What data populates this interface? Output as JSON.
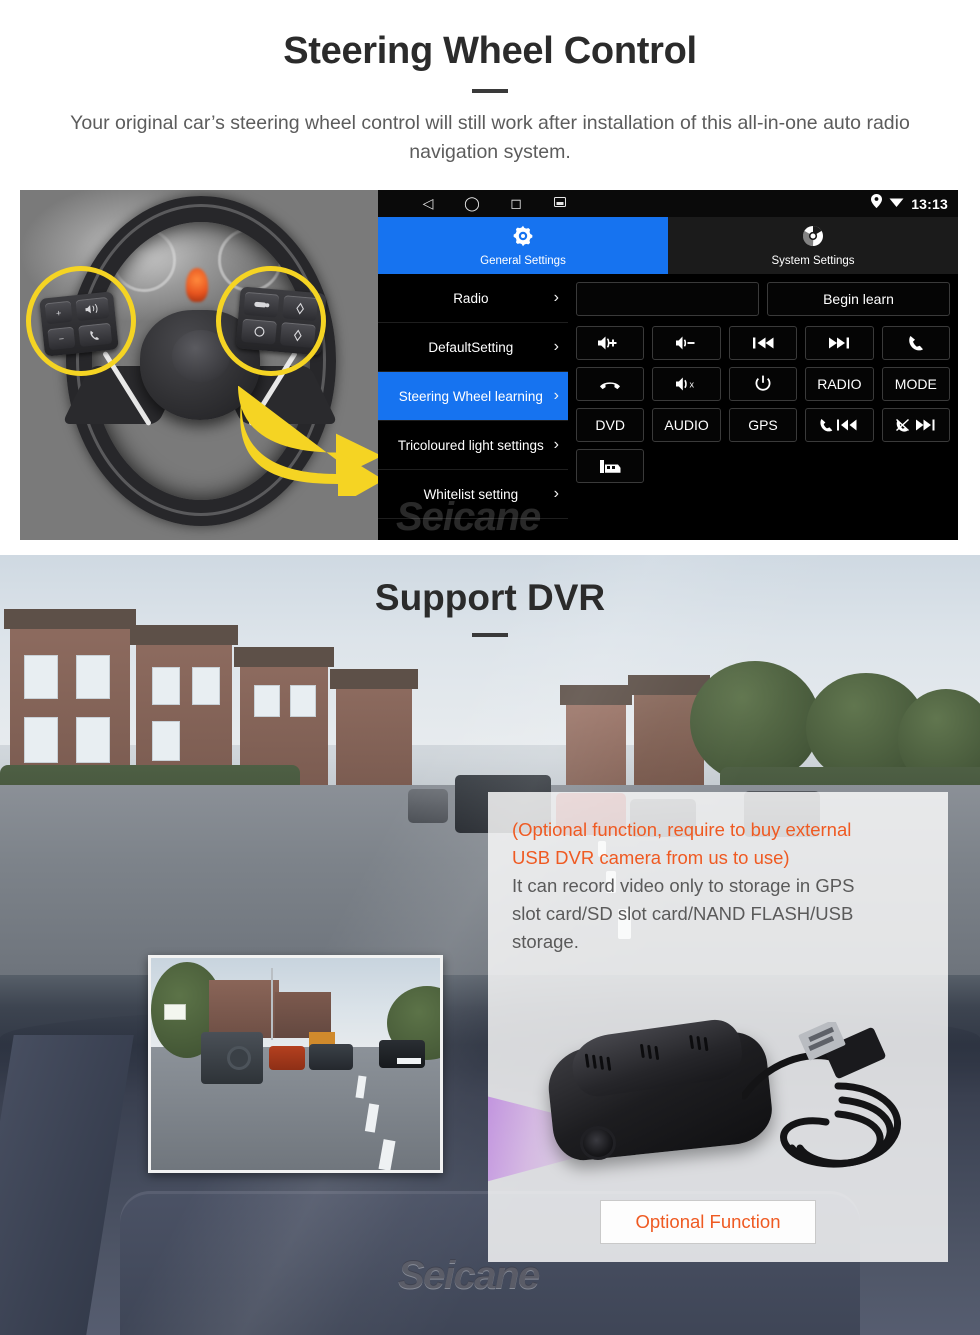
{
  "steering_section": {
    "title": "Steering Wheel Control",
    "subtitle": "Your original car’s steering wheel control will still work after installation of this all-in-one auto radio navigation system.",
    "wheel_photo": {
      "alt_name": "steering-wheel-photo",
      "left_controls": [
        "+",
        "-",
        "voice-assist",
        "call"
      ],
      "right_controls": [
        "media",
        "up-arrow",
        "mode",
        "down-arrow"
      ]
    },
    "head_unit": {
      "status_bar": {
        "nav_icons": [
          "back-icon",
          "home-icon",
          "recents-icon",
          "screenshot-icon"
        ],
        "location_icon": "location-pin-icon",
        "wifi_icon": "wifi-icon",
        "clock": "13:13"
      },
      "tabs": [
        {
          "label": "General Settings",
          "icon": "gear-icon",
          "active": true
        },
        {
          "label": "System Settings",
          "icon": "chrome-icon",
          "active": false
        }
      ],
      "menu": [
        {
          "label": "Radio",
          "selected": false
        },
        {
          "label": "DefaultSetting",
          "selected": false
        },
        {
          "label": "Steering Wheel learning",
          "selected": true
        },
        {
          "label": "Tricoloured light settings",
          "selected": false
        },
        {
          "label": "Whitelist setting",
          "selected": false
        }
      ],
      "learn_field_value": "",
      "learn_field_placeholder": "",
      "begin_learn_label": "Begin learn",
      "key_buttons": [
        {
          "label": "",
          "icon": "volume-up-icon"
        },
        {
          "label": "",
          "icon": "volume-down-icon"
        },
        {
          "label": "",
          "icon": "previous-track-icon"
        },
        {
          "label": "",
          "icon": "next-track-icon"
        },
        {
          "label": "",
          "icon": "phone-answer-icon"
        },
        {
          "label": "",
          "icon": "phone-hangup-icon"
        },
        {
          "label": "",
          "icon": "mute-icon"
        },
        {
          "label": "",
          "icon": "power-icon"
        },
        {
          "label": "RADIO",
          "icon": ""
        },
        {
          "label": "MODE",
          "icon": ""
        },
        {
          "label": "DVD",
          "icon": ""
        },
        {
          "label": "AUDIO",
          "icon": ""
        },
        {
          "label": "GPS",
          "icon": ""
        },
        {
          "label": "",
          "icon": "call-previous-icon"
        },
        {
          "label": "",
          "icon": "call-reject-next-icon"
        }
      ],
      "extra_button": {
        "label": "",
        "icon": "car-screen-icon"
      },
      "watermark": "Seicane",
      "accent_color": "#1673f0"
    }
  },
  "dvr_section": {
    "title": "Support DVR",
    "footage_name": "dashcam-footage-thumbnail",
    "panel": {
      "accent_line_1": "(Optional function, require to buy external",
      "accent_line_2": "USB DVR camera from us to use)",
      "body_line_1": "It can record video only to storage in GPS",
      "body_line_2": "slot card/SD slot card/NAND FLASH/USB",
      "body_line_3": "storage.",
      "product_name": "usb-dvr-camera-product-photo",
      "optional_button_label": "Optional Function",
      "accent_color": "#ef5a22"
    },
    "watermark": "Seicane"
  }
}
